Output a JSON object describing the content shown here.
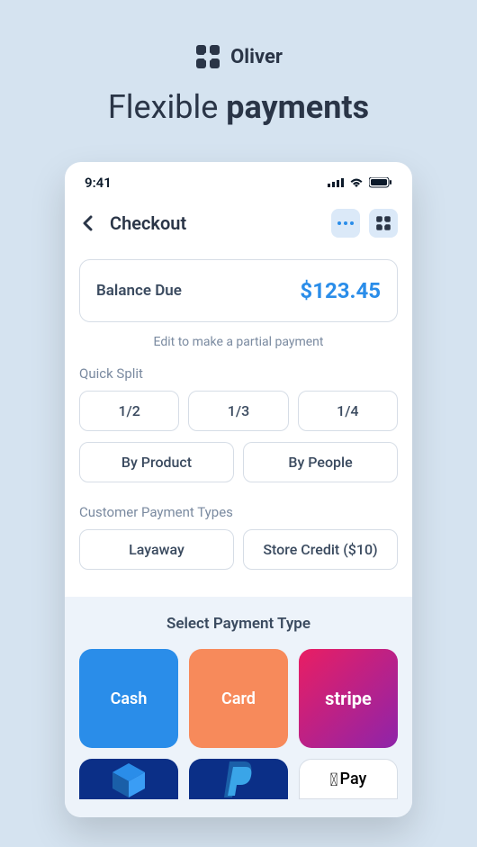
{
  "brand": {
    "name": "Oliver"
  },
  "title_light": "Flexible ",
  "title_bold": "payments",
  "status": {
    "time": "9:41"
  },
  "nav": {
    "title": "Checkout"
  },
  "balance": {
    "label": "Balance Due",
    "amount": "$123.45",
    "hint": "Edit to make a partial payment"
  },
  "quick_split": {
    "label": "Quick Split",
    "fractions": [
      "1/2",
      "1/3",
      "1/4"
    ],
    "by_product": "By Product",
    "by_people": "By People"
  },
  "customer_types": {
    "label": "Customer Payment Types",
    "layaway": "Layaway",
    "store_credit": "Store Credit ($10)"
  },
  "payment": {
    "title": "Select Payment Type",
    "cash": "Cash",
    "card": "Card",
    "stripe": "stripe",
    "applepay": "Pay"
  }
}
